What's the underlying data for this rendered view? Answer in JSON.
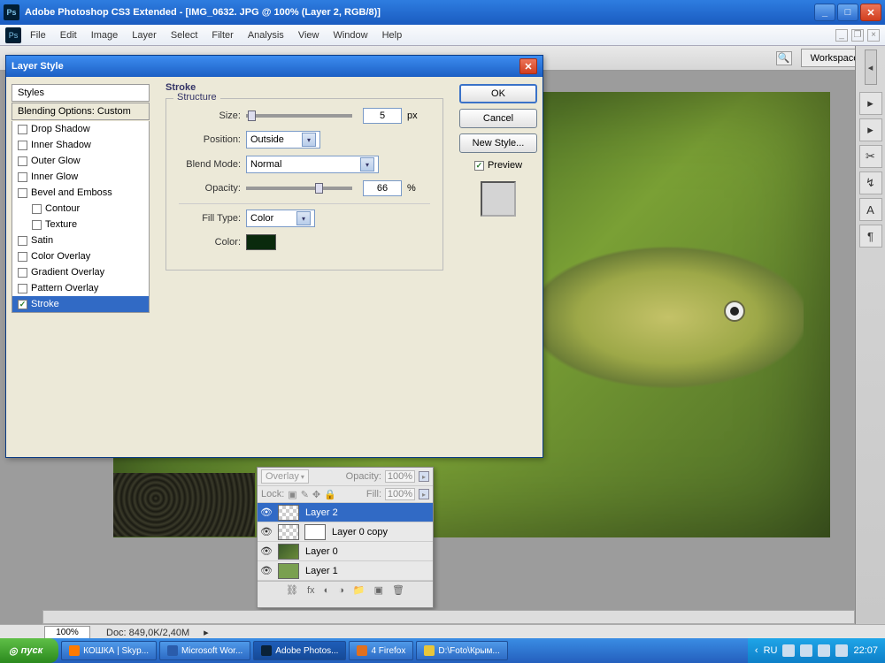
{
  "titlebar": {
    "app": "Adobe Photoshop CS3 Extended",
    "doc": "[IMG_0632. JPG @ 100% (Layer 2, RGB/8)]"
  },
  "menus": [
    "File",
    "Edit",
    "Image",
    "Layer",
    "Select",
    "Filter",
    "Analysis",
    "View",
    "Window",
    "Help"
  ],
  "workspace_btn": "Workspace ▾",
  "dialog": {
    "title": "Layer Style",
    "styles_header": "Styles",
    "blending_opts": "Blending Options: Custom",
    "styles": [
      {
        "label": "Drop Shadow",
        "checked": false
      },
      {
        "label": "Inner Shadow",
        "checked": false
      },
      {
        "label": "Outer Glow",
        "checked": false
      },
      {
        "label": "Inner Glow",
        "checked": false
      },
      {
        "label": "Bevel and Emboss",
        "checked": false
      },
      {
        "label": "Contour",
        "checked": false,
        "indent": true
      },
      {
        "label": "Texture",
        "checked": false,
        "indent": true
      },
      {
        "label": "Satin",
        "checked": false
      },
      {
        "label": "Color Overlay",
        "checked": false
      },
      {
        "label": "Gradient Overlay",
        "checked": false
      },
      {
        "label": "Pattern Overlay",
        "checked": false
      },
      {
        "label": "Stroke",
        "checked": true,
        "selected": true
      }
    ],
    "panel_title": "Stroke",
    "structure": "Structure",
    "size_label": "Size:",
    "size_val": "5",
    "size_unit": "px",
    "position_label": "Position:",
    "position_val": "Outside",
    "blend_label": "Blend Mode:",
    "blend_val": "Normal",
    "opacity_label": "Opacity:",
    "opacity_val": "66",
    "opacity_unit": "%",
    "filltype_label": "Fill Type:",
    "filltype_val": "Color",
    "color_label": "Color:",
    "ok": "OK",
    "cancel": "Cancel",
    "newstyle": "New Style...",
    "preview": "Preview"
  },
  "layers_panel": {
    "mode": "Overlay",
    "opacity_label": "Opacity:",
    "opacity": "100%",
    "lock": "Lock:",
    "fill_label": "Fill:",
    "fill": "100%",
    "layers": [
      {
        "name": "Layer 2",
        "sel": true,
        "thumb": "chk"
      },
      {
        "name": "Layer 0 copy",
        "sel": false,
        "thumb": "chk",
        "mask": true
      },
      {
        "name": "Layer 0",
        "sel": false,
        "thumb": "img"
      },
      {
        "name": "Layer 1",
        "sel": false,
        "thumb": "green"
      }
    ]
  },
  "status": {
    "zoom": "100%",
    "doc": "Doc: 849,0K/2,40M"
  },
  "taskbar": {
    "start": "пуск",
    "buttons": [
      {
        "label": "КОШКА | Skyp...",
        "color": "#ff7a00"
      },
      {
        "label": "Microsoft Wor...",
        "color": "#2a5cab"
      },
      {
        "label": "Adobe Photos...",
        "color": "#0a2238",
        "active": true
      },
      {
        "label": "4 Firefox",
        "color": "#e07020"
      },
      {
        "label": "D:\\Foto\\Крым...",
        "color": "#e8c63a"
      }
    ],
    "lang": "RU",
    "time": "22:07"
  }
}
